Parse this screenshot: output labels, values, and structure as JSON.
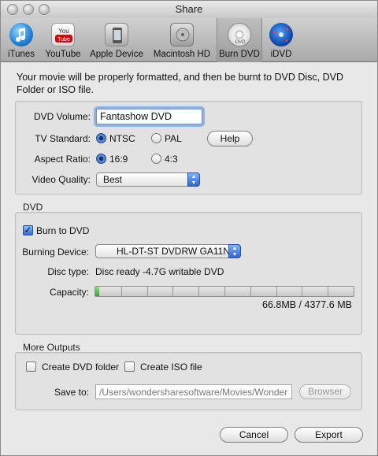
{
  "window": {
    "title": "Share"
  },
  "toolbar": {
    "items": [
      {
        "label": "iTunes",
        "icon": "itunes-icon",
        "selected": false
      },
      {
        "label": "YouTube",
        "icon": "youtube-icon",
        "selected": false
      },
      {
        "label": "Apple Device",
        "icon": "apple-device-icon",
        "selected": false
      },
      {
        "label": "Macintosh HD",
        "icon": "hard-disk-icon",
        "selected": false
      },
      {
        "label": "Burn DVD",
        "icon": "dvd-disc-icon",
        "selected": true
      },
      {
        "label": "iDVD",
        "icon": "idvd-icon",
        "selected": false
      }
    ]
  },
  "description": "Your movie will be properly formatted, and then be burnt to DVD Disc, DVD Folder or ISO file.",
  "settings": {
    "dvd_volume_label": "DVD Volume:",
    "dvd_volume_value": "Fantashow DVD",
    "tv_standard_label": "TV Standard:",
    "tv_ntsc": "NTSC",
    "tv_pal": "PAL",
    "tv_selected": "NTSC",
    "help_button": "Help",
    "aspect_label": "Aspect Ratio:",
    "aspect_169": "16:9",
    "aspect_43": "4:3",
    "aspect_selected": "16:9",
    "quality_label": "Video Quality:",
    "quality_value": "Best"
  },
  "dvd": {
    "section_title": "DVD",
    "burn_label": "Burn to DVD",
    "burn_checked": true,
    "device_label": "Burning Device:",
    "device_value": "HL-DT-ST DVDRW GA11N",
    "disc_type_label": "Disc type:",
    "disc_type_value": "Disc ready -4.7G writable DVD",
    "capacity_label": "Capacity:",
    "capacity_text": "66.8MB / 4377.6 MB",
    "capacity_fraction": 0.0153
  },
  "more_outputs": {
    "section_title": "More Outputs",
    "create_folder": "Create DVD folder",
    "create_folder_checked": false,
    "create_iso": "Create ISO file",
    "create_iso_checked": false,
    "save_to_label": "Save to:",
    "save_to_value": "/Users/wondersharesoftware/Movies/Wonder",
    "browser_button": "Browser"
  },
  "buttons": {
    "cancel": "Cancel",
    "export": "Export"
  },
  "colors": {
    "accent": "#2b66cf",
    "capacity_fill": "#2ea42e"
  }
}
